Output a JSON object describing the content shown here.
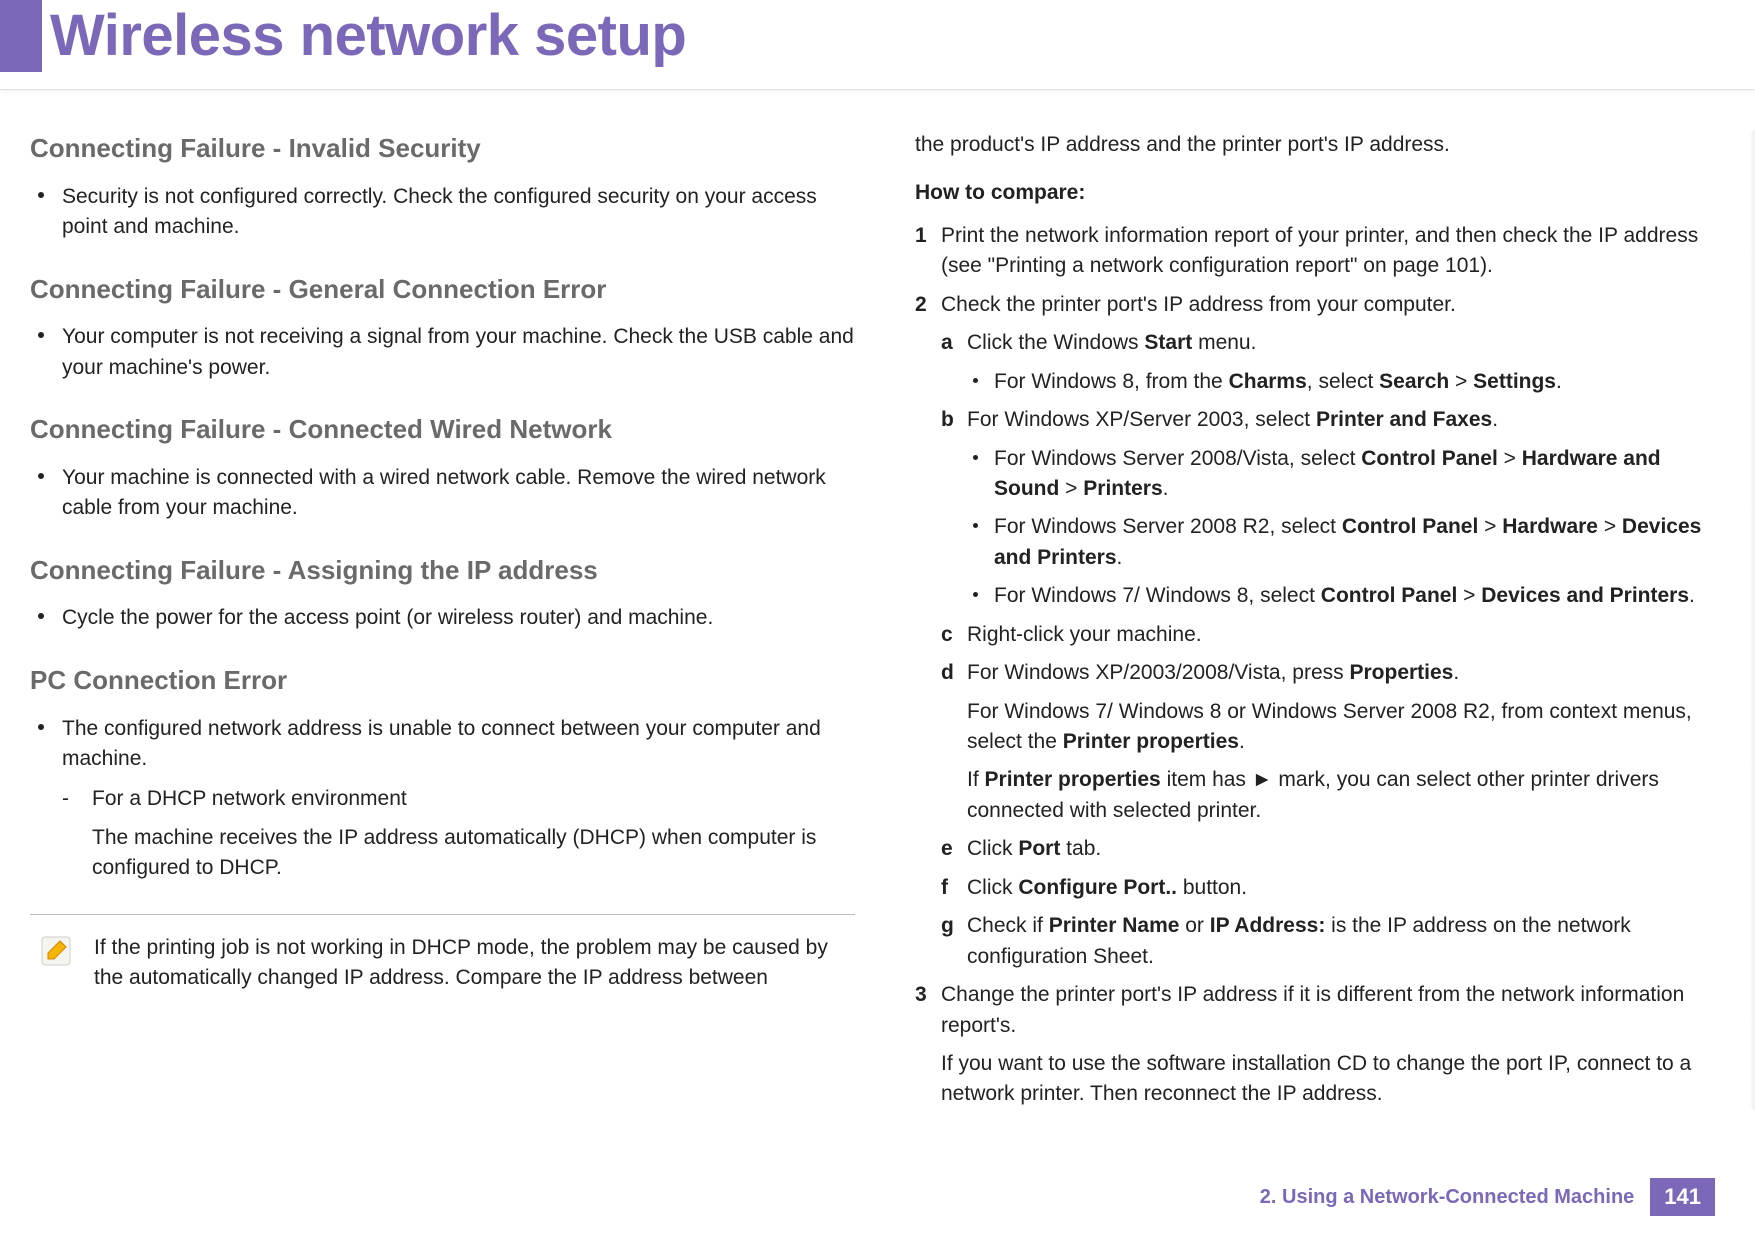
{
  "header": {
    "title": "Wireless network setup"
  },
  "left": {
    "s1": {
      "heading": "Connecting Failure - Invalid Security",
      "b1": "Security is not configured correctly. Check the configured security on your access point and machine."
    },
    "s2": {
      "heading": "Connecting Failure - General Connection Error",
      "b1": "Your computer is not receiving a signal from your machine. Check the USB cable and your machine's power."
    },
    "s3": {
      "heading": "Connecting Failure - Connected Wired Network",
      "b1": "Your machine is connected with a wired network cable. Remove the wired network cable from your machine."
    },
    "s4": {
      "heading": "Connecting Failure - Assigning the IP address",
      "b1": "Cycle the power for the access point (or wireless router) and machine."
    },
    "s5": {
      "heading": "PC Connection Error",
      "b1": "The configured network address is unable to connect between your computer and machine.",
      "sub_marker": "-",
      "sub_text": "For a DHCP network environment",
      "sub_para": "The machine receives the IP address automatically (DHCP) when computer is configured to DHCP."
    },
    "note": "If the printing job is not working in DHCP mode, the problem may be caused by the automatically changed IP address. Compare the IP address between"
  },
  "right": {
    "lead": "the product's IP address and the printer port's IP address.",
    "compare_heading": "How to compare:",
    "n1": "Print the network information report of your printer, and then check the IP address (see \"Printing a network configuration report\" on page 101).",
    "n2": "Check the printer port's IP address from your computer.",
    "la_pre": "Click the Windows ",
    "la_bold": "Start",
    "la_post": " menu.",
    "la_sub_pre": "For Windows 8, from the ",
    "la_sub_b1": "Charms",
    "la_sub_mid1": ", select ",
    "la_sub_b2": "Search",
    "la_sub_mid2": " > ",
    "la_sub_b3": "Settings",
    "la_sub_end": ".",
    "lb_pre": "For Windows XP/Server 2003, select ",
    "lb_bold": "Printer and Faxes",
    "lb_end": ".",
    "lb_s1_pre": "For Windows Server 2008/Vista, select ",
    "lb_s1_b1": "Control Panel",
    "lb_s1_m1": " > ",
    "lb_s1_b2": "Hardware and Sound",
    "lb_s1_m2": " > ",
    "lb_s1_b3": "Printers",
    "lb_s1_end": ".",
    "lb_s2_pre": "For Windows Server 2008 R2, select ",
    "lb_s2_b1": "Control Panel",
    "lb_s2_m1": " > ",
    "lb_s2_b2": "Hardware",
    "lb_s2_m2": " > ",
    "lb_s2_b3": "Devices and Printers",
    "lb_s2_end": ".",
    "lb_s3_pre": "For Windows 7/ Windows 8, select ",
    "lb_s3_b1": "Control Panel",
    "lb_s3_m1": " > ",
    "lb_s3_b2": "Devices and Printers",
    "lb_s3_end": ".",
    "lc": "Right-click your machine.",
    "ld_pre": "For Windows XP/2003/2008/Vista, press ",
    "ld_bold": "Properties",
    "ld_end": ".",
    "ld_p2_pre": "For Windows 7/ Windows 8 or Windows Server 2008 R2, from context menus, select the ",
    "ld_p2_bold": "Printer properties",
    "ld_p2_end": ".",
    "ld_p3_pre": "If ",
    "ld_p3_bold": "Printer properties",
    "ld_p3_post": " item has ► mark, you can select other printer drivers connected with selected printer.",
    "le_pre": "Click ",
    "le_bold": "Port",
    "le_post": " tab.",
    "lf_pre": "Click ",
    "lf_bold": "Configure Port..",
    "lf_post": " button.",
    "lg_pre": "Check if ",
    "lg_b1": "Printer Name",
    "lg_mid": " or ",
    "lg_b2": "IP Address:",
    "lg_post": " is the IP address on the network configuration Sheet.",
    "n3": "Change the printer port's IP address if it is different from the network information report's.",
    "n3_p2": "If you  want to use the software installation CD to change the port IP, connect to a network printer. Then reconnect the IP address."
  },
  "footer": {
    "section": "2.  Using a Network-Connected Machine",
    "page": "141"
  },
  "markers": {
    "n1": "1",
    "n2": "2",
    "n3": "3",
    "la": "a",
    "lb": "b",
    "lc": "c",
    "ld": "d",
    "le": "e",
    "lf": "f",
    "lg": "g"
  }
}
